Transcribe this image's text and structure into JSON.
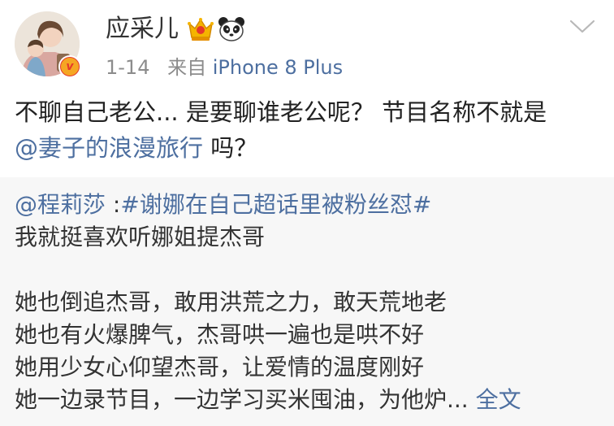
{
  "post": {
    "username": "应采儿",
    "time": "1-14",
    "source_prefix": "来自",
    "source": "iPhone 8 Plus",
    "text_part1": "不聊自己老公... 是要聊谁老公呢？ 节目名称不就是",
    "mention": "@妻子的浪漫旅行",
    "text_part2": " 吗？",
    "badges": [
      "crown-icon",
      "panda-icon"
    ],
    "verified_icon": "verified-v-icon"
  },
  "repost": {
    "author": "@程莉莎",
    "separator": " :",
    "topic": "#谢娜在自己超话里被粉丝怼#",
    "lines": [
      "我就挺喜欢听娜姐提杰哥",
      "她也倒追杰哥，敢用洪荒之力，敢天荒地老",
      "她也有火爆脾气，杰哥哄一遍也是哄不好",
      "她用少女心仰望杰哥，让爱情的温度刚好"
    ],
    "last_line": "她一边录节目，一边学习买米囤油，为他炉...",
    "more_link": "全文"
  },
  "colors": {
    "link": "#4d6fa0",
    "meta": "#8c8c8c",
    "repost_bg": "#f7f7f7"
  }
}
